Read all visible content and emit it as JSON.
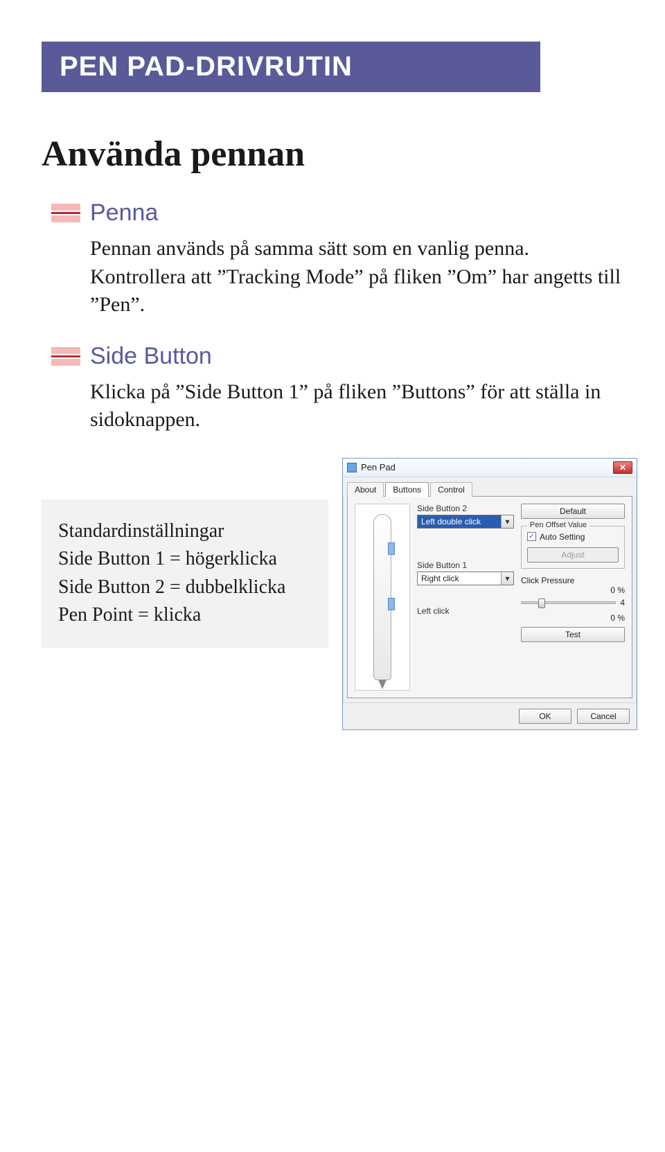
{
  "banner": "PEN PAD-DRIVRUTIN",
  "heading": "Använda pennan",
  "sections": {
    "penna": {
      "title": "Penna",
      "text": "Pennan används på samma sätt som en vanlig penna. Kontrollera att ”Tracking Mode” på fliken ”Om” har angetts till ”Pen”."
    },
    "sidebutton": {
      "title": "Side Button",
      "text": "Klicka på ”Side Button 1” på fliken ”Buttons” för att ställa in sidoknappen."
    }
  },
  "defaults": {
    "heading": "Standardinställningar",
    "line1": "Side Button 1 = högerklicka",
    "line2": "Side Button 2 = dubbelklicka",
    "line3": "Pen Point = klicka"
  },
  "dialog": {
    "title": "Pen Pad",
    "tabs": {
      "about": "About",
      "buttons": "Buttons",
      "control": "Control"
    },
    "sb2_label": "Side Button 2",
    "sb2_value": "Left double click",
    "sb1_label": "Side Button 1",
    "sb1_value": "Right click",
    "leftclick_label": "Left click",
    "default_btn": "Default",
    "offset_group": "Pen Offset Value",
    "auto_setting": "Auto Setting",
    "adjust_btn": "Adjust",
    "pressure_label": "Click Pressure",
    "pct_top": "0 %",
    "slider_val": "4",
    "pct_bot": "0 %",
    "test_btn": "Test",
    "ok": "OK",
    "cancel": "Cancel"
  }
}
